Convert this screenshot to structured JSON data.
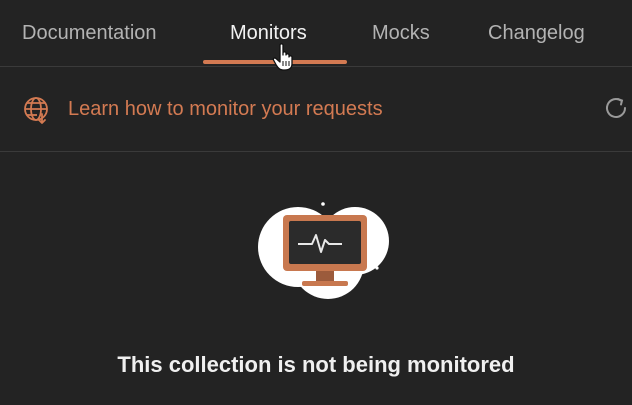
{
  "tabs": [
    {
      "label": "Documentation",
      "active": false
    },
    {
      "label": "Monitors",
      "active": true
    },
    {
      "label": "Mocks",
      "active": false
    },
    {
      "label": "Changelog",
      "active": false
    }
  ],
  "learn_link": {
    "label": "Learn how to monitor your requests",
    "icon": "globe-icon"
  },
  "refresh_icon": "refresh-icon",
  "empty_state": {
    "title": "This collection is not being monitored",
    "illustration": "monitor-heartbeat-illustration"
  },
  "colors": {
    "background": "#232323",
    "accent": "#d37a52",
    "text_primary": "#f2f2f2",
    "text_secondary": "#b3b3b3",
    "divider": "#3a3a3a"
  }
}
